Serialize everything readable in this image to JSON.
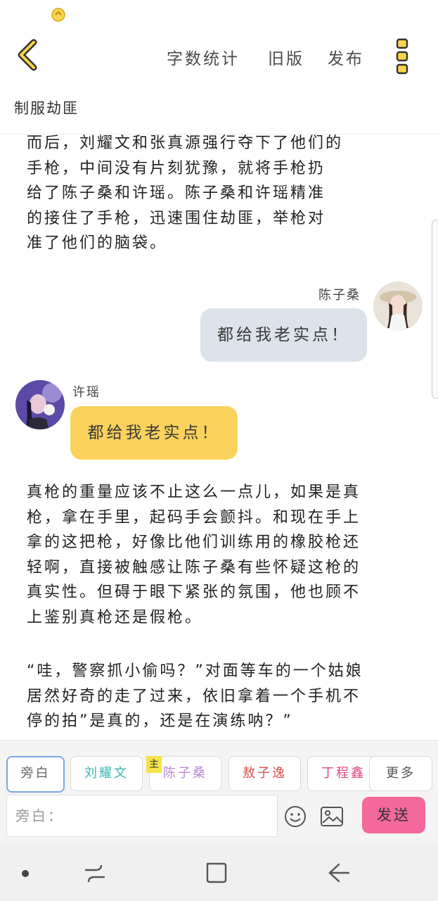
{
  "header": {
    "word_count_label": "字数统计",
    "old_version_label": "旧版",
    "publish_label": "发布"
  },
  "story": {
    "title": "制服劫匪"
  },
  "messages": [
    {
      "type": "narration",
      "lines": [
        "而后，刘耀文和张真源强行夺下了他们的",
        "手枪，中间没有片刻犹豫，就将手枪扔",
        "给了陈子桑和许瑶。陈子桑和许瑶精准",
        "的接住了手枪，迅速围住劫匪，举枪对",
        "准了他们的脑袋。"
      ]
    },
    {
      "type": "dialogue",
      "side": "right",
      "speaker": "陈子桑",
      "text": "都给我老实点！"
    },
    {
      "type": "dialogue",
      "side": "left",
      "speaker": "许瑶",
      "text": "都给我老实点！"
    },
    {
      "type": "narration",
      "lines": [
        "真枪的重量应该不止这么一点儿，如果是真",
        "枪，拿在手里，起码手会颤抖。和现在手上",
        "拿的这把枪，好像比他们训练用的橡胶枪还",
        "轻啊，直接被触感让陈子桑有些怀疑这枪的",
        "真实性。但碍于眼下紧张的氛围，他也顾不",
        "上鉴别真枪还是假枪。"
      ]
    },
    {
      "type": "narration",
      "lines": [
        "“哇，警察抓小偷吗？”对面等车的一个姑娘",
        "居然好奇的走了过来，依旧拿着一个手机不",
        "停的拍”是真的，还是在演练呐？”"
      ]
    }
  ],
  "roles": [
    {
      "label": "旁白",
      "color": "#666666",
      "active": true
    },
    {
      "label": "刘耀文",
      "color": "#3ab5b0"
    },
    {
      "label": "陈子桑",
      "color": "#b98ad0",
      "badge": "主"
    },
    {
      "label": "敖子逸",
      "color": "#d9534f"
    },
    {
      "label": "丁程鑫",
      "color": "#e0457b"
    },
    {
      "label": "更多",
      "color": "#555555"
    }
  ],
  "input": {
    "prefix": "旁白："
  },
  "send_label": "发送",
  "colors": {
    "accent_yellow": "#f7d44c",
    "send_pink": "#f3699b",
    "left_bubble": "#fad25c",
    "right_bubble": "#dde3ea"
  }
}
